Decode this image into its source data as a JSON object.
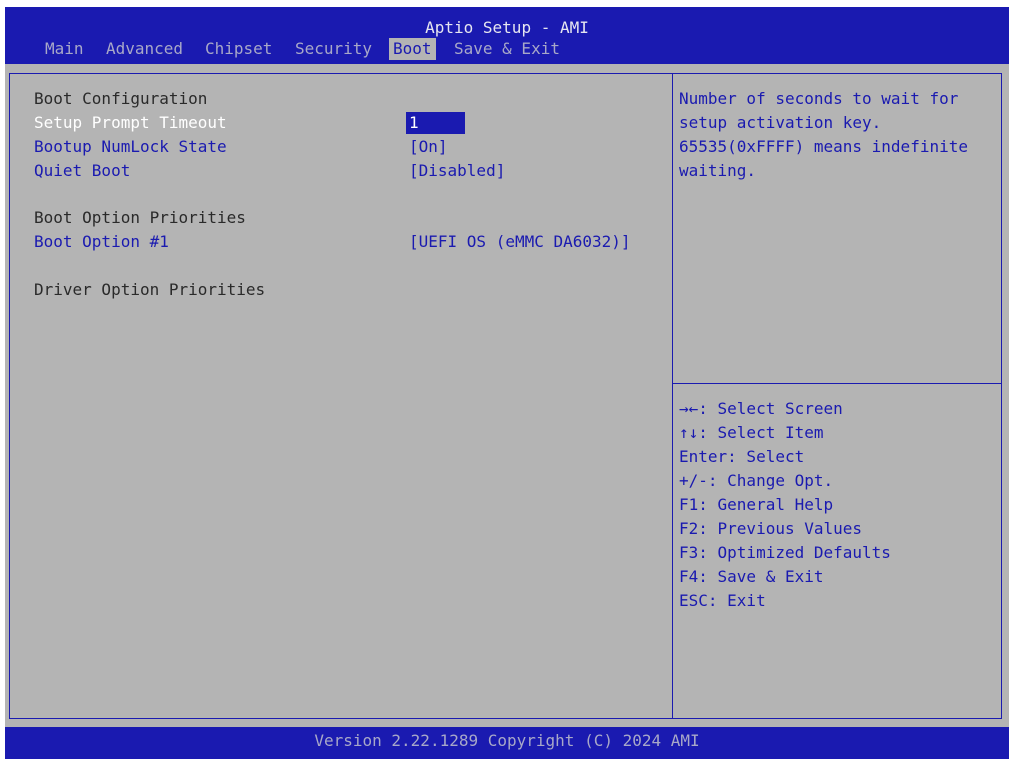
{
  "window": {
    "title": "Aptio Setup - AMI"
  },
  "tabs": [
    {
      "label": "Main"
    },
    {
      "label": "Advanced"
    },
    {
      "label": "Chipset"
    },
    {
      "label": "Security"
    },
    {
      "label": "Boot"
    },
    {
      "label": "Save & Exit"
    }
  ],
  "active_tab": "Boot",
  "main": {
    "boot_configuration": "Boot Configuration",
    "setup_prompt_timeout": {
      "label": "Setup Prompt Timeout",
      "value": "1"
    },
    "bootup_numlock_state": {
      "label": "Bootup NumLock State",
      "value": "[On]"
    },
    "quiet_boot": {
      "label": "Quiet Boot",
      "value": "[Disabled]"
    },
    "boot_option_priorities": "Boot Option Priorities",
    "boot_option_1": {
      "label": "Boot Option #1",
      "value": "[UEFI OS (eMMC DA6032)]"
    },
    "driver_option_priorities": "Driver Option Priorities"
  },
  "help": {
    "description_lines": [
      "Number of seconds to wait for",
      "setup activation key.",
      "65535(0xFFFF) means indefinite",
      "waiting."
    ],
    "keys": [
      "→←: Select Screen",
      "↑↓: Select Item",
      "Enter: Select",
      "+/-: Change Opt.",
      "F1: General Help",
      "F2: Previous Values",
      "F3: Optimized Defaults",
      "F4: Save & Exit",
      "ESC: Exit"
    ]
  },
  "footer": {
    "version": "Version 2.22.1289 Copyright (C) 2024 AMI"
  },
  "colors": {
    "bar_blue": "#1a1ab0",
    "panel_gray": "#b4b4b4",
    "heading_text": "#2a2a2a",
    "selected_text": "#ffffff"
  }
}
